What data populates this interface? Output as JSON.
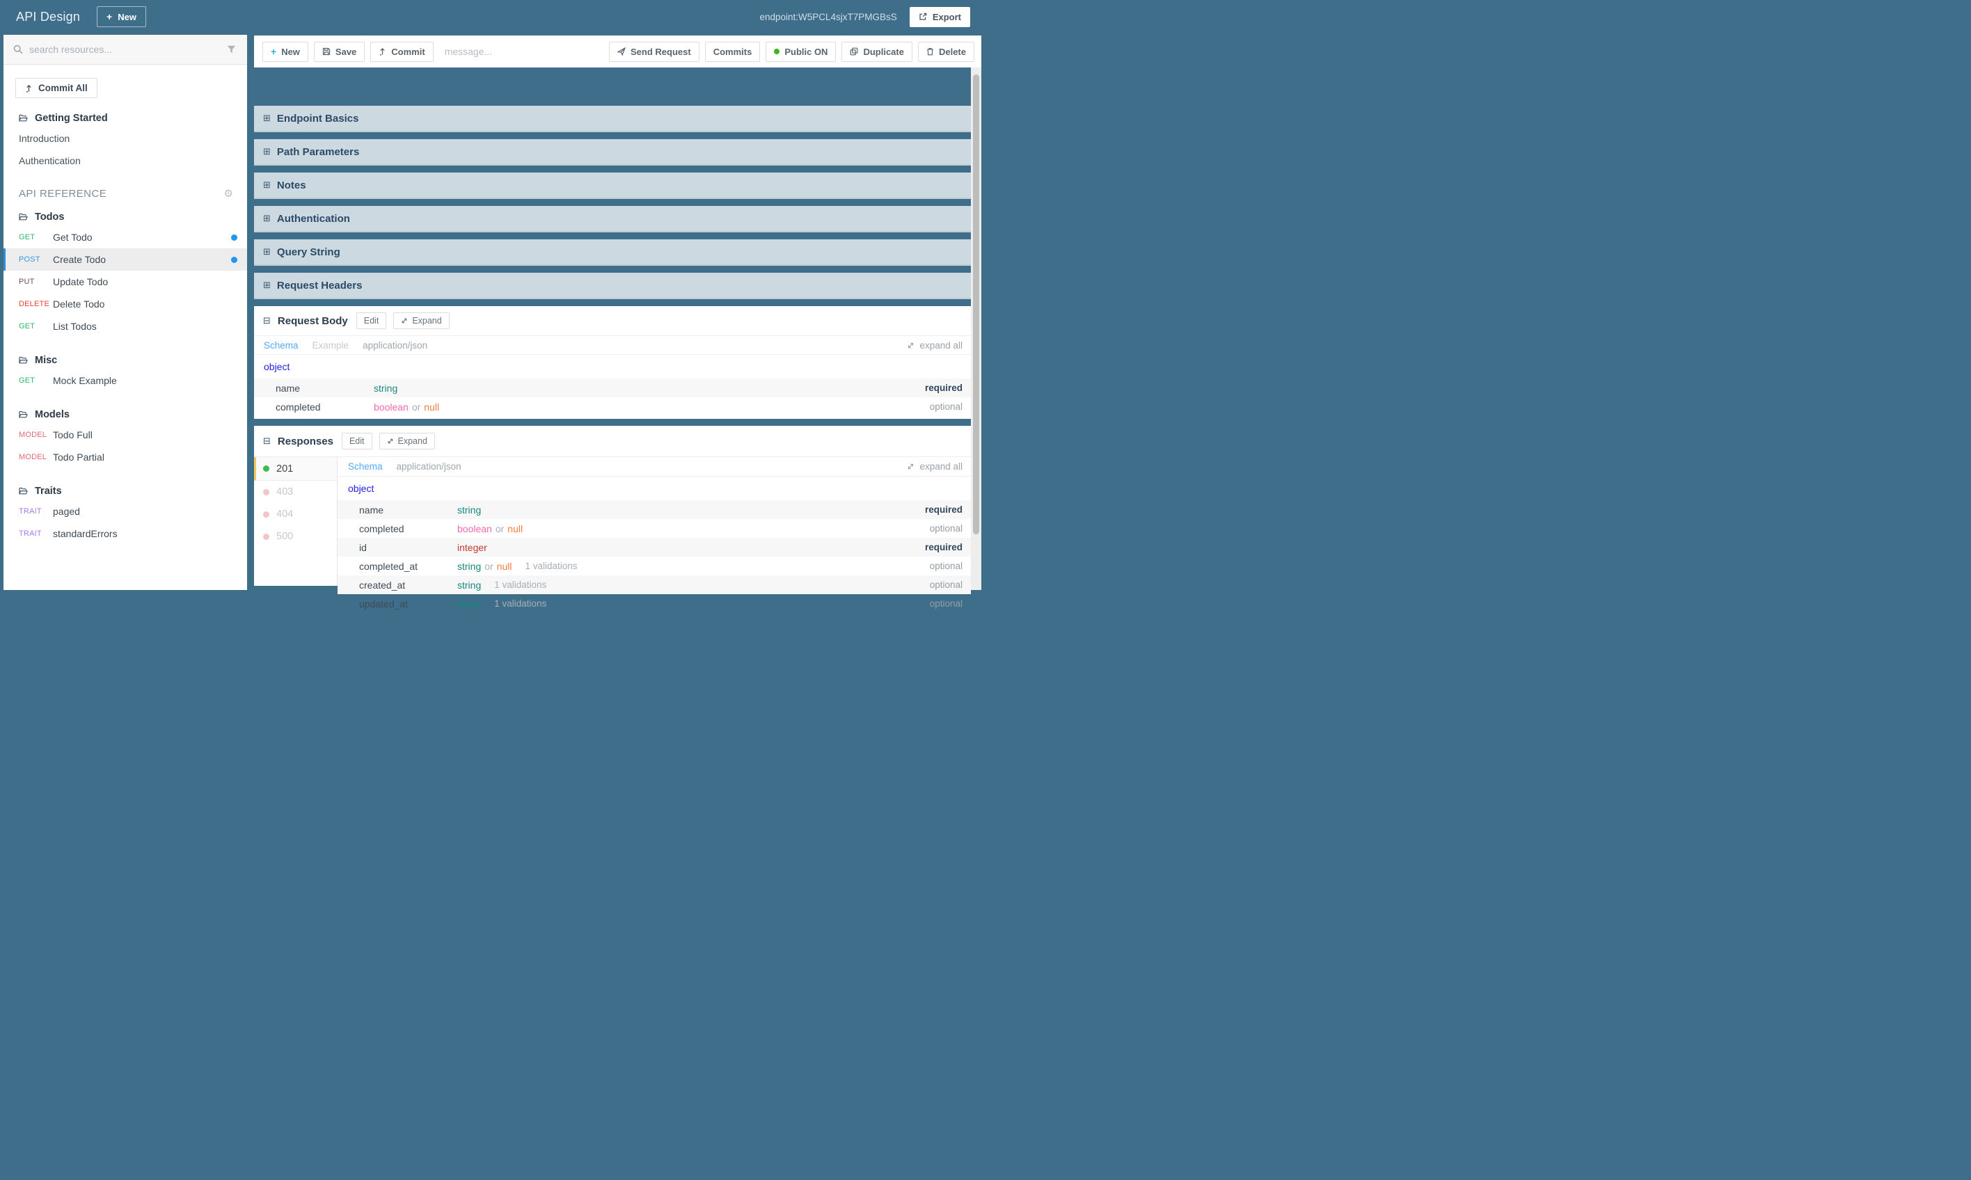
{
  "colors": {
    "page_bg": "#3F6E8B",
    "panel_bar_bg": "#CCD9E0",
    "bar_text": "#2B4A66",
    "selected_border_blue": "#2D8CD8",
    "tab_link_blue": "#54A9F7",
    "object_blue": "#2222DF",
    "type_string": "#17877D",
    "type_boolean": "#F06AAE",
    "type_null": "#F97B3C",
    "type_integer": "#C23B2E",
    "method_get": "#2BB962",
    "method_post": "#3B97E0",
    "method_put": "#7A4B4B",
    "method_delete": "#E8432E",
    "method_model": "#E26877",
    "method_trait": "#A478E8",
    "unsaved_dot_blue": "#2196F3",
    "status_green": "#3CBB4E",
    "status_pink_dot": "#F6C3C6",
    "response_selected_yellow": "#F2C760",
    "public_on_green": "#3CB521",
    "new_plus_blue": "#29B0E8"
  },
  "topbar": {
    "title": "API Design",
    "new_label": "New",
    "endpoint": "endpoint:W5PCL4sjxT7PMGBsS",
    "export_label": "Export"
  },
  "sidebar": {
    "search_placeholder": "search resources...",
    "commit_all_label": "Commit All",
    "getting_started": {
      "title": "Getting Started",
      "items": [
        "Introduction",
        "Authentication"
      ]
    },
    "api_reference_label": "API REFERENCE",
    "groups": [
      {
        "title": "Todos",
        "items": [
          {
            "method": "GET",
            "label": "Get Todo",
            "dot": true
          },
          {
            "method": "POST",
            "label": "Create Todo",
            "dot": true,
            "selected": true
          },
          {
            "method": "PUT",
            "label": "Update Todo"
          },
          {
            "method": "DELETE",
            "label": "Delete Todo"
          },
          {
            "method": "GET",
            "label": "List Todos"
          }
        ]
      },
      {
        "title": "Misc",
        "items": [
          {
            "method": "GET",
            "label": "Mock Example"
          }
        ]
      },
      {
        "title": "Models",
        "items": [
          {
            "method": "MODEL",
            "label": "Todo Full"
          },
          {
            "method": "MODEL",
            "label": "Todo Partial"
          }
        ]
      },
      {
        "title": "Traits",
        "items": [
          {
            "method": "TRAIT",
            "label": "paged"
          },
          {
            "method": "TRAIT",
            "label": "standardErrors"
          }
        ]
      }
    ]
  },
  "toolbar": {
    "new_label": "New",
    "save_label": "Save",
    "commit_label": "Commit",
    "message_placeholder": "message...",
    "send_request_label": "Send Request",
    "commits_label": "Commits",
    "public_label": "Public ON",
    "duplicate_label": "Duplicate",
    "delete_label": "Delete"
  },
  "collapsed_sections": [
    "Endpoint Basics",
    "Path Parameters",
    "Notes",
    "Authentication",
    "Query String",
    "Request Headers"
  ],
  "request_body": {
    "title": "Request Body",
    "edit_label": "Edit",
    "expand_label": "Expand",
    "tabs": [
      "Schema",
      "Example",
      "application/json"
    ],
    "expand_all_label": "expand all",
    "root_type": "object",
    "rows": [
      {
        "name": "name",
        "types": [
          {
            "text": "string",
            "cls": "string"
          }
        ],
        "flag": "required"
      },
      {
        "name": "completed",
        "types": [
          {
            "text": "boolean",
            "cls": "boolean"
          },
          {
            "text": "or",
            "cls": "or"
          },
          {
            "text": "null",
            "cls": "null"
          }
        ],
        "flag": "optional"
      }
    ]
  },
  "responses": {
    "title": "Responses",
    "edit_label": "Edit",
    "expand_label": "Expand",
    "statuses": [
      {
        "code": "201",
        "tone": "success",
        "selected": true
      },
      {
        "code": "403",
        "tone": "error"
      },
      {
        "code": "404",
        "tone": "error"
      },
      {
        "code": "500",
        "tone": "error"
      }
    ],
    "tabs": [
      "Schema",
      "application/json"
    ],
    "expand_all_label": "expand all",
    "root_type": "object",
    "rows": [
      {
        "name": "name",
        "types": [
          {
            "text": "string",
            "cls": "string"
          }
        ],
        "flag": "required"
      },
      {
        "name": "completed",
        "types": [
          {
            "text": "boolean",
            "cls": "boolean"
          },
          {
            "text": "or",
            "cls": "or"
          },
          {
            "text": "null",
            "cls": "null"
          }
        ],
        "flag": "optional"
      },
      {
        "name": "id",
        "types": [
          {
            "text": "integer",
            "cls": "integer"
          }
        ],
        "flag": "required"
      },
      {
        "name": "completed_at",
        "types": [
          {
            "text": "string",
            "cls": "string"
          },
          {
            "text": "or",
            "cls": "or"
          },
          {
            "text": "null",
            "cls": "null"
          }
        ],
        "validations": "1 validations",
        "flag": "optional"
      },
      {
        "name": "created_at",
        "types": [
          {
            "text": "string",
            "cls": "string"
          }
        ],
        "validations": "1 validations",
        "flag": "optional"
      },
      {
        "name": "updated_at",
        "types": [
          {
            "text": "string",
            "cls": "string"
          }
        ],
        "validations": "1 validations",
        "flag": "optional"
      }
    ]
  }
}
